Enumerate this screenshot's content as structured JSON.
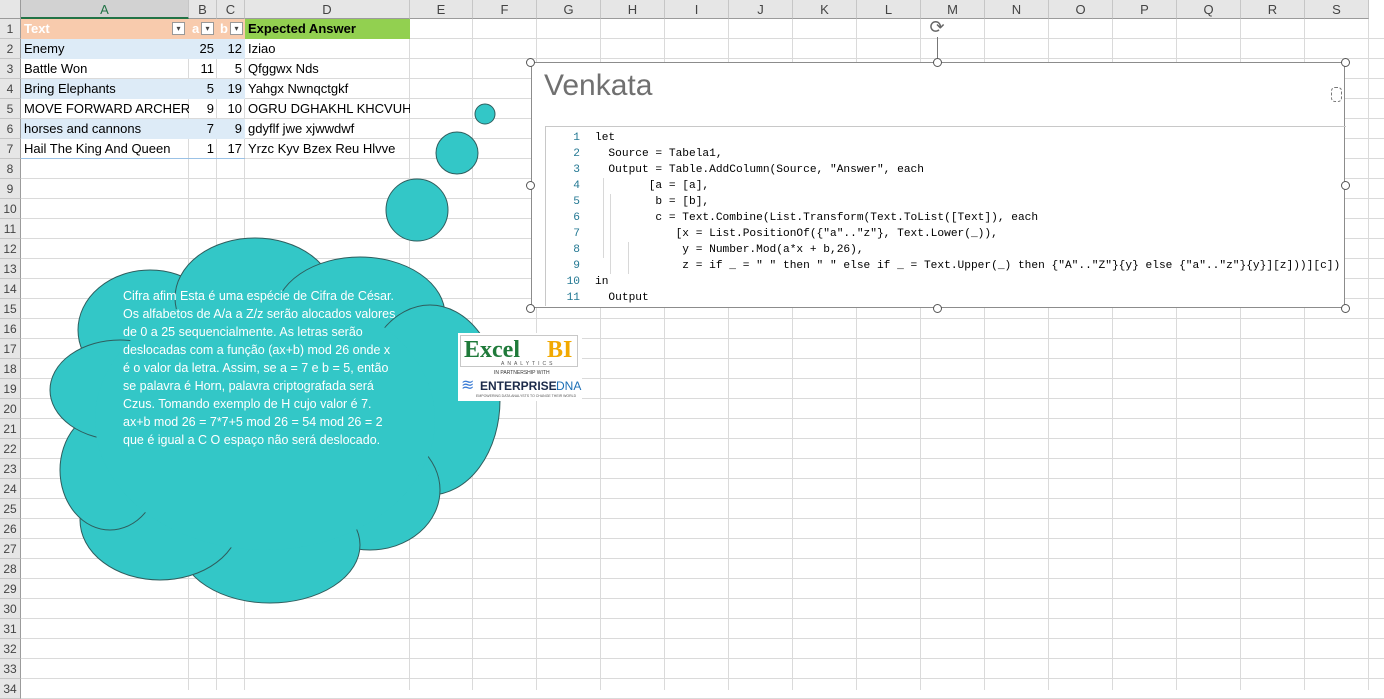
{
  "columns": [
    "A",
    "B",
    "C",
    "D",
    "E",
    "F",
    "G",
    "H",
    "I",
    "J",
    "K",
    "L",
    "M",
    "N",
    "O",
    "P",
    "Q",
    "R",
    "S"
  ],
  "rows": [
    "1",
    "2",
    "3",
    "4",
    "5",
    "6",
    "7",
    "8",
    "9",
    "10",
    "11",
    "12",
    "13",
    "14",
    "15",
    "16",
    "17",
    "18",
    "19",
    "20",
    "21",
    "22",
    "23",
    "24",
    "25",
    "26",
    "27",
    "28",
    "29",
    "30",
    "31",
    "32",
    "33",
    "34"
  ],
  "table": {
    "headers": [
      "Text",
      "a",
      "b",
      "Expected Answer"
    ],
    "rows": [
      {
        "text": "Enemy",
        "a": "25",
        "b": "12",
        "answer": "Iziao"
      },
      {
        "text": "Battle Won",
        "a": "11",
        "b": "5",
        "answer": "Qfggwx Nds"
      },
      {
        "text": "Bring Elephants",
        "a": "5",
        "b": "19",
        "answer": "Yahgx Nwnqctgkf"
      },
      {
        "text": "MOVE FORWARD ARCHERS",
        "a": "9",
        "b": "10",
        "answer": "OGRU DGHAKHL KHCVUHQ"
      },
      {
        "text": "horses and cannons",
        "a": "7",
        "b": "9",
        "answer": "gdyflf jwe xjwwdwf"
      },
      {
        "text": "Hail The King And Queen",
        "a": "1",
        "b": "17",
        "answer": "Yrzc Kyv Bzex Reu Hlvve"
      }
    ]
  },
  "callout": {
    "text": " Cifra afim Esta é uma espécie de Cifra de César.  Os alfabetos de A/a a Z/z serão alocados valores de 0 a 25 sequencialmente. As letras serão deslocadas com a função (ax+b) mod 26 onde x é o valor da letra. Assim, se a = 7 e b = 5, então  se palavra é Horn, palavra criptografada será Czus. Tomando exemplo de H cujo valor é 7. ax+b mod 26 = 7*7+5 mod 26 = 54 mod 26 = 2 que é igual a C O espaço não será deslocado.",
    "color": "#33c7c7"
  },
  "code_panel": {
    "title": "Venkata",
    "line_numbers": [
      "1",
      "2",
      "3",
      "4",
      "5",
      "6",
      "7",
      "8",
      "9",
      "10",
      "11"
    ],
    "lines": [
      "let",
      "  Source = Tabela1,",
      "  Output = Table.AddColumn(Source, \"Answer\", each",
      "        [a = [a],",
      "         b = [b],",
      "         c = Text.Combine(List.Transform(Text.ToList([Text]), each",
      "            [x = List.PositionOf({\"a\"..\"z\"}, Text.Lower(_)),",
      "             y = Number.Mod(a*x + b,26),",
      "             z = if _ = \" \" then \" \" else if _ = Text.Upper(_) then {\"A\"..\"Z\"}{y} else {\"a\"..\"z\"}{y}][z]))][c])",
      "in",
      "  Output"
    ]
  },
  "logo": {
    "brand_excel": "Excel",
    "brand_bi": "BI",
    "brand_sub": "ANALYTICS",
    "partnership": "IN PARTNERSHIP WITH",
    "partner": "ENTERPRISE",
    "partner_dna": "DNA",
    "tagline": "EMPOWERING DATA ANALYSTS TO CHANGE THEIR WORLD"
  },
  "colors": {
    "header_text_fill": "#f8cbad",
    "header_answer_fill": "#92d050",
    "band_fill": "#ddebf7",
    "excel_green": "#217346"
  }
}
